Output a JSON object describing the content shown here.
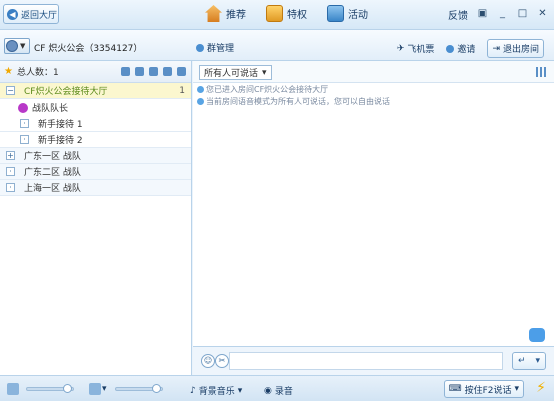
{
  "topbar": {
    "back_label": "返回大厅",
    "nav": [
      {
        "label": "推荐",
        "icon": "home-icon"
      },
      {
        "label": "特权",
        "icon": "gift-icon"
      },
      {
        "label": "活动",
        "icon": "activity-icon"
      }
    ],
    "feedback_label": "反馈"
  },
  "roombar": {
    "room_title": "CF 炽火公会（3354127）",
    "group_manage": "群管理",
    "flight_ticket": "飞机票",
    "invite": "邀请",
    "exit_room": "退出房间"
  },
  "left": {
    "total_label": "总人数：1",
    "channels": [
      {
        "label": "CF炽火公会接待大厅",
        "count": "1",
        "type": "hall"
      },
      {
        "label": "战队队长",
        "type": "member"
      },
      {
        "label": "新手接待 1",
        "type": "sub"
      },
      {
        "label": "新手接待 2",
        "type": "sub"
      },
      {
        "label": "广东一区 战队",
        "type": "group"
      },
      {
        "label": "广东二区 战队",
        "type": "group"
      },
      {
        "label": "上海一区 战队",
        "type": "group"
      }
    ]
  },
  "chat": {
    "speak_mode": "所有人可说话",
    "messages": [
      "您已进入房间CF炽火公会接待大厅",
      "当前房间语音模式为所有人可说话，您可以自由说话"
    ]
  },
  "bottombar": {
    "bg_music": "背景音乐",
    "record": "录音",
    "push_to_talk": "按住F2说话"
  }
}
